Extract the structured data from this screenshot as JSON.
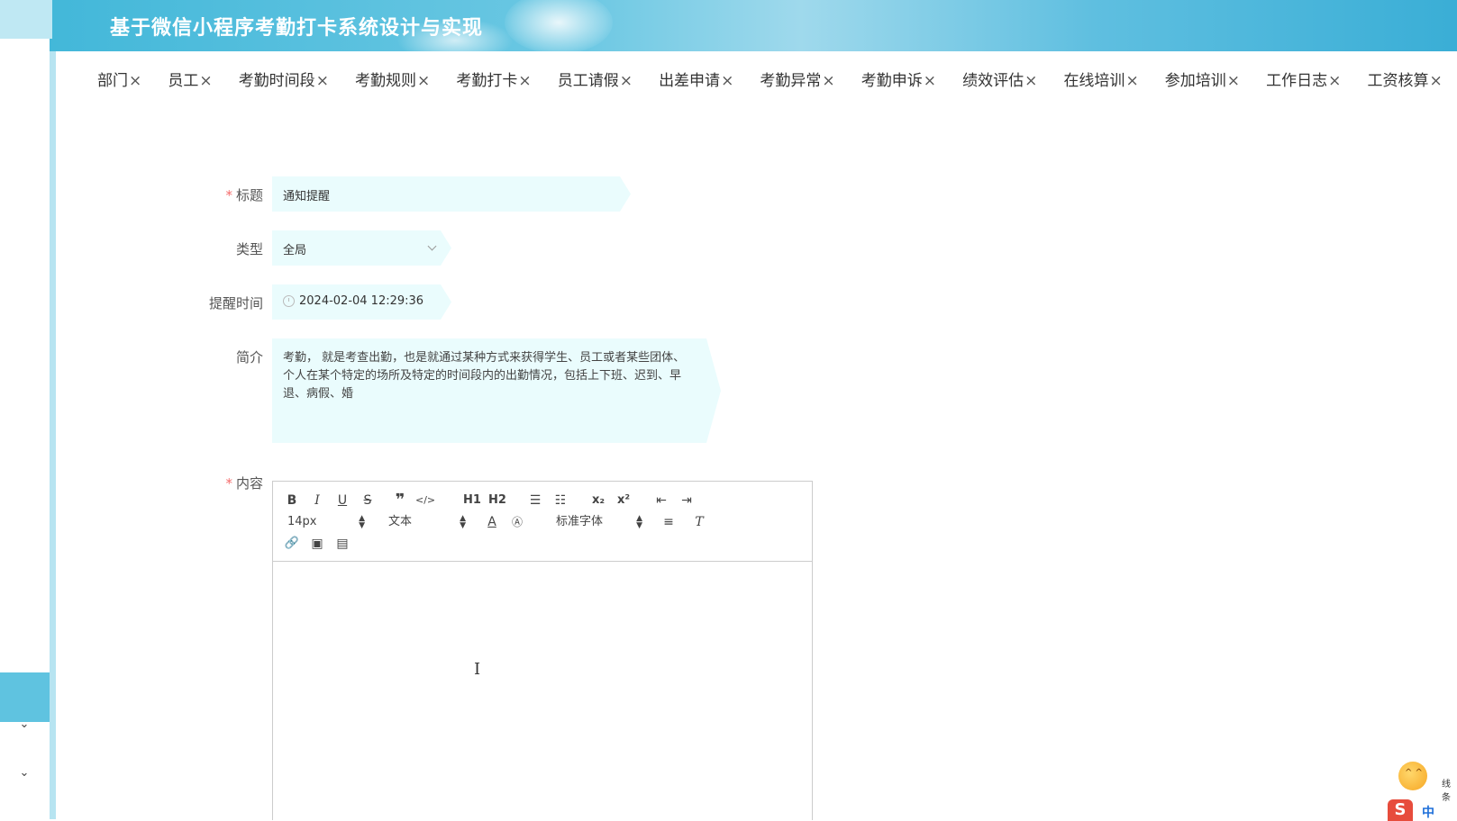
{
  "header": {
    "title": "基于微信小程序考勤打卡系统设计与实现"
  },
  "tabs": [
    {
      "label": "部门"
    },
    {
      "label": "员工"
    },
    {
      "label": "考勤时间段"
    },
    {
      "label": "考勤规则"
    },
    {
      "label": "考勤打卡"
    },
    {
      "label": "员工请假"
    },
    {
      "label": "出差申请"
    },
    {
      "label": "考勤异常"
    },
    {
      "label": "考勤申诉"
    },
    {
      "label": "绩效评估"
    },
    {
      "label": "在线培训"
    },
    {
      "label": "参加培训"
    },
    {
      "label": "工作日志"
    },
    {
      "label": "工资核算"
    }
  ],
  "tab_close": "×",
  "form": {
    "required_mark": "*",
    "title_label": "标题",
    "title_value": "通知提醒",
    "type_label": "类型",
    "type_value": "全局",
    "time_label": "提醒时间",
    "time_value": "2024-02-04 12:29:36",
    "intro_label": "简介",
    "intro_value": "考勤， 就是考查出勤，也是就通过某种方式来获得学生、员工或者某些团体、个人在某个特定的场所及特定的时间段内的出勤情况，包括上下班、迟到、早退、病假、婚",
    "content_label": "内容"
  },
  "editor": {
    "font_size": "14px",
    "header_select": "文本",
    "font_family": "标准字体",
    "h1": "H1",
    "h2": "H2"
  },
  "ime": {
    "zh": "中",
    "text": "线条"
  },
  "colors": {
    "accent": "#5fc3e0",
    "field_bg": "#eafcfd",
    "required": "#f56c6c"
  }
}
